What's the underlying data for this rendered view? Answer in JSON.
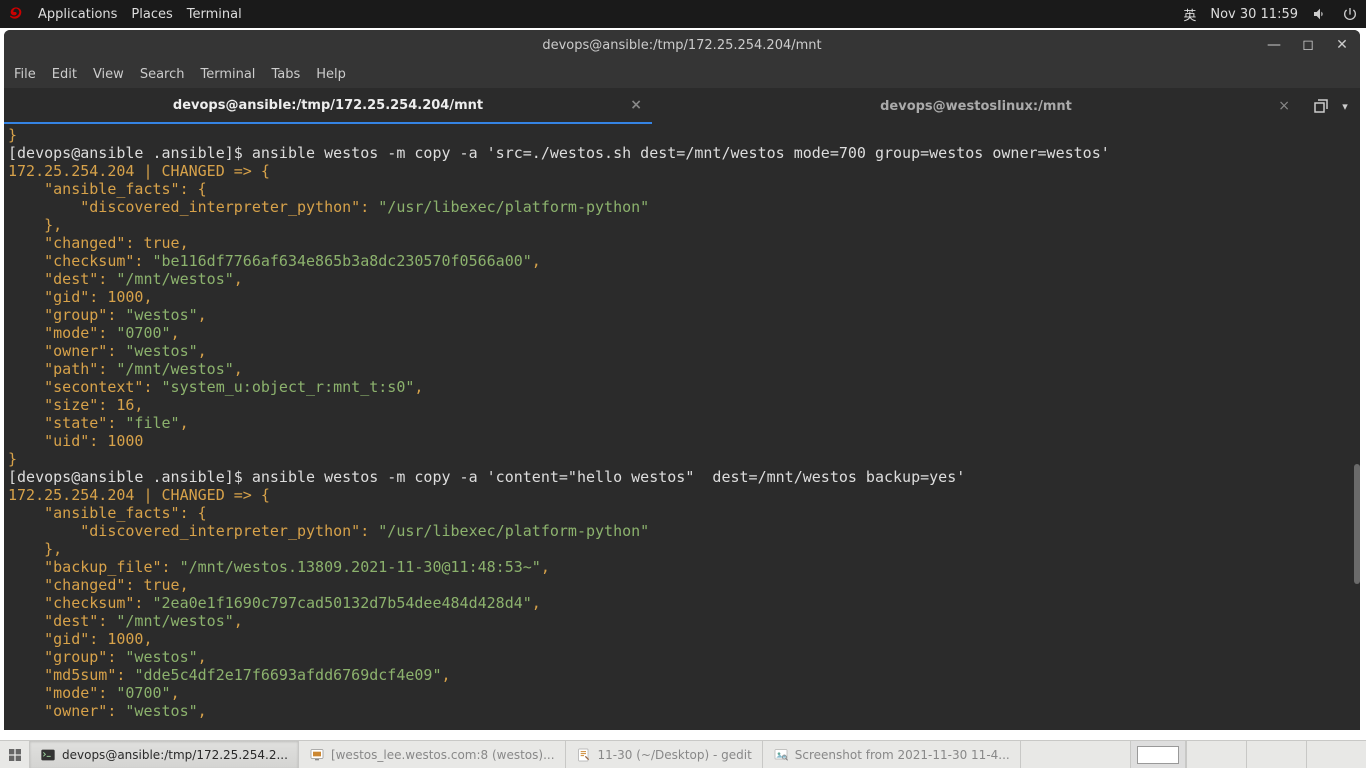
{
  "panel": {
    "apps": "Applications",
    "places": "Places",
    "terminal": "Terminal",
    "ime": "英",
    "clock": "Nov 30  11:59"
  },
  "window": {
    "title": "devops@ansible:/tmp/172.25.254.204/mnt",
    "menu": [
      "File",
      "Edit",
      "View",
      "Search",
      "Terminal",
      "Tabs",
      "Help"
    ],
    "tabs": [
      {
        "label": "devops@ansible:/tmp/172.25.254.204/mnt",
        "active": true
      },
      {
        "label": "devops@westoslinux:/mnt",
        "active": false
      }
    ]
  },
  "term": {
    "brace_close": "}",
    "prompt1": "[devops@ansible .ansible]$ ",
    "cmd1": "ansible westos -m copy -a 'src=./westos.sh dest=/mnt/westos mode=700 group=westos owner=westos'",
    "host": "172.25.254.204 | ",
    "changed": "CHANGED",
    "arrow": " => {",
    "af_open": "    \"ansible_facts\": {",
    "af_dip_key": "        \"discovered_interpreter_python\": ",
    "af_dip_val": "\"/usr/libexec/platform-python\"",
    "af_close": "    },",
    "changed_true": "    \"changed\": true,",
    "checksum_key": "    \"checksum\": ",
    "checksum1_val": "\"be116df7766af634e865b3a8dc230570f0566a00\"",
    "dest_key": "    \"dest\": ",
    "dest_val": "\"/mnt/westos\"",
    "gid": "    \"gid\": 1000,",
    "group_key": "    \"group\": ",
    "group_val": "\"westos\"",
    "mode_key": "    \"mode\": ",
    "mode_val": "\"0700\"",
    "owner_key": "    \"owner\": ",
    "owner_val": "\"westos\"",
    "path_key": "    \"path\": ",
    "path_val": "\"/mnt/westos\"",
    "secontext_key": "    \"secontext\": ",
    "secontext_val": "\"system_u:object_r:mnt_t:s0\"",
    "size": "    \"size\": 16,",
    "state_key": "    \"state\": ",
    "state_val": "\"file\"",
    "uid": "    \"uid\": 1000",
    "prompt2": "[devops@ansible .ansible]$ ",
    "cmd2": "ansible westos -m copy -a 'content=\"hello westos\"  dest=/mnt/westos backup=yes'",
    "backup_key": "    \"backup_file\": ",
    "backup_val": "\"/mnt/westos.13809.2021-11-30@11:48:53~\"",
    "checksum2_val": "\"2ea0e1f1690c797cad50132d7b54dee484d428d4\"",
    "md5_key": "    \"md5sum\": ",
    "md5_val": "\"dde5c4df2e17f6693afdd6769dcf4e09\"",
    "comma": ","
  },
  "taskbar": {
    "items": [
      {
        "label": "devops@ansible:/tmp/172.25.254.2...",
        "active": true,
        "icon": "terminal"
      },
      {
        "label": "[westos_lee.westos.com:8 (westos)...",
        "active": false,
        "icon": "vm"
      },
      {
        "label": "11-30 (~/Desktop) - gedit",
        "active": false,
        "icon": "gedit"
      },
      {
        "label": "Screenshot from 2021-11-30 11-4...",
        "active": false,
        "icon": "image"
      }
    ]
  }
}
